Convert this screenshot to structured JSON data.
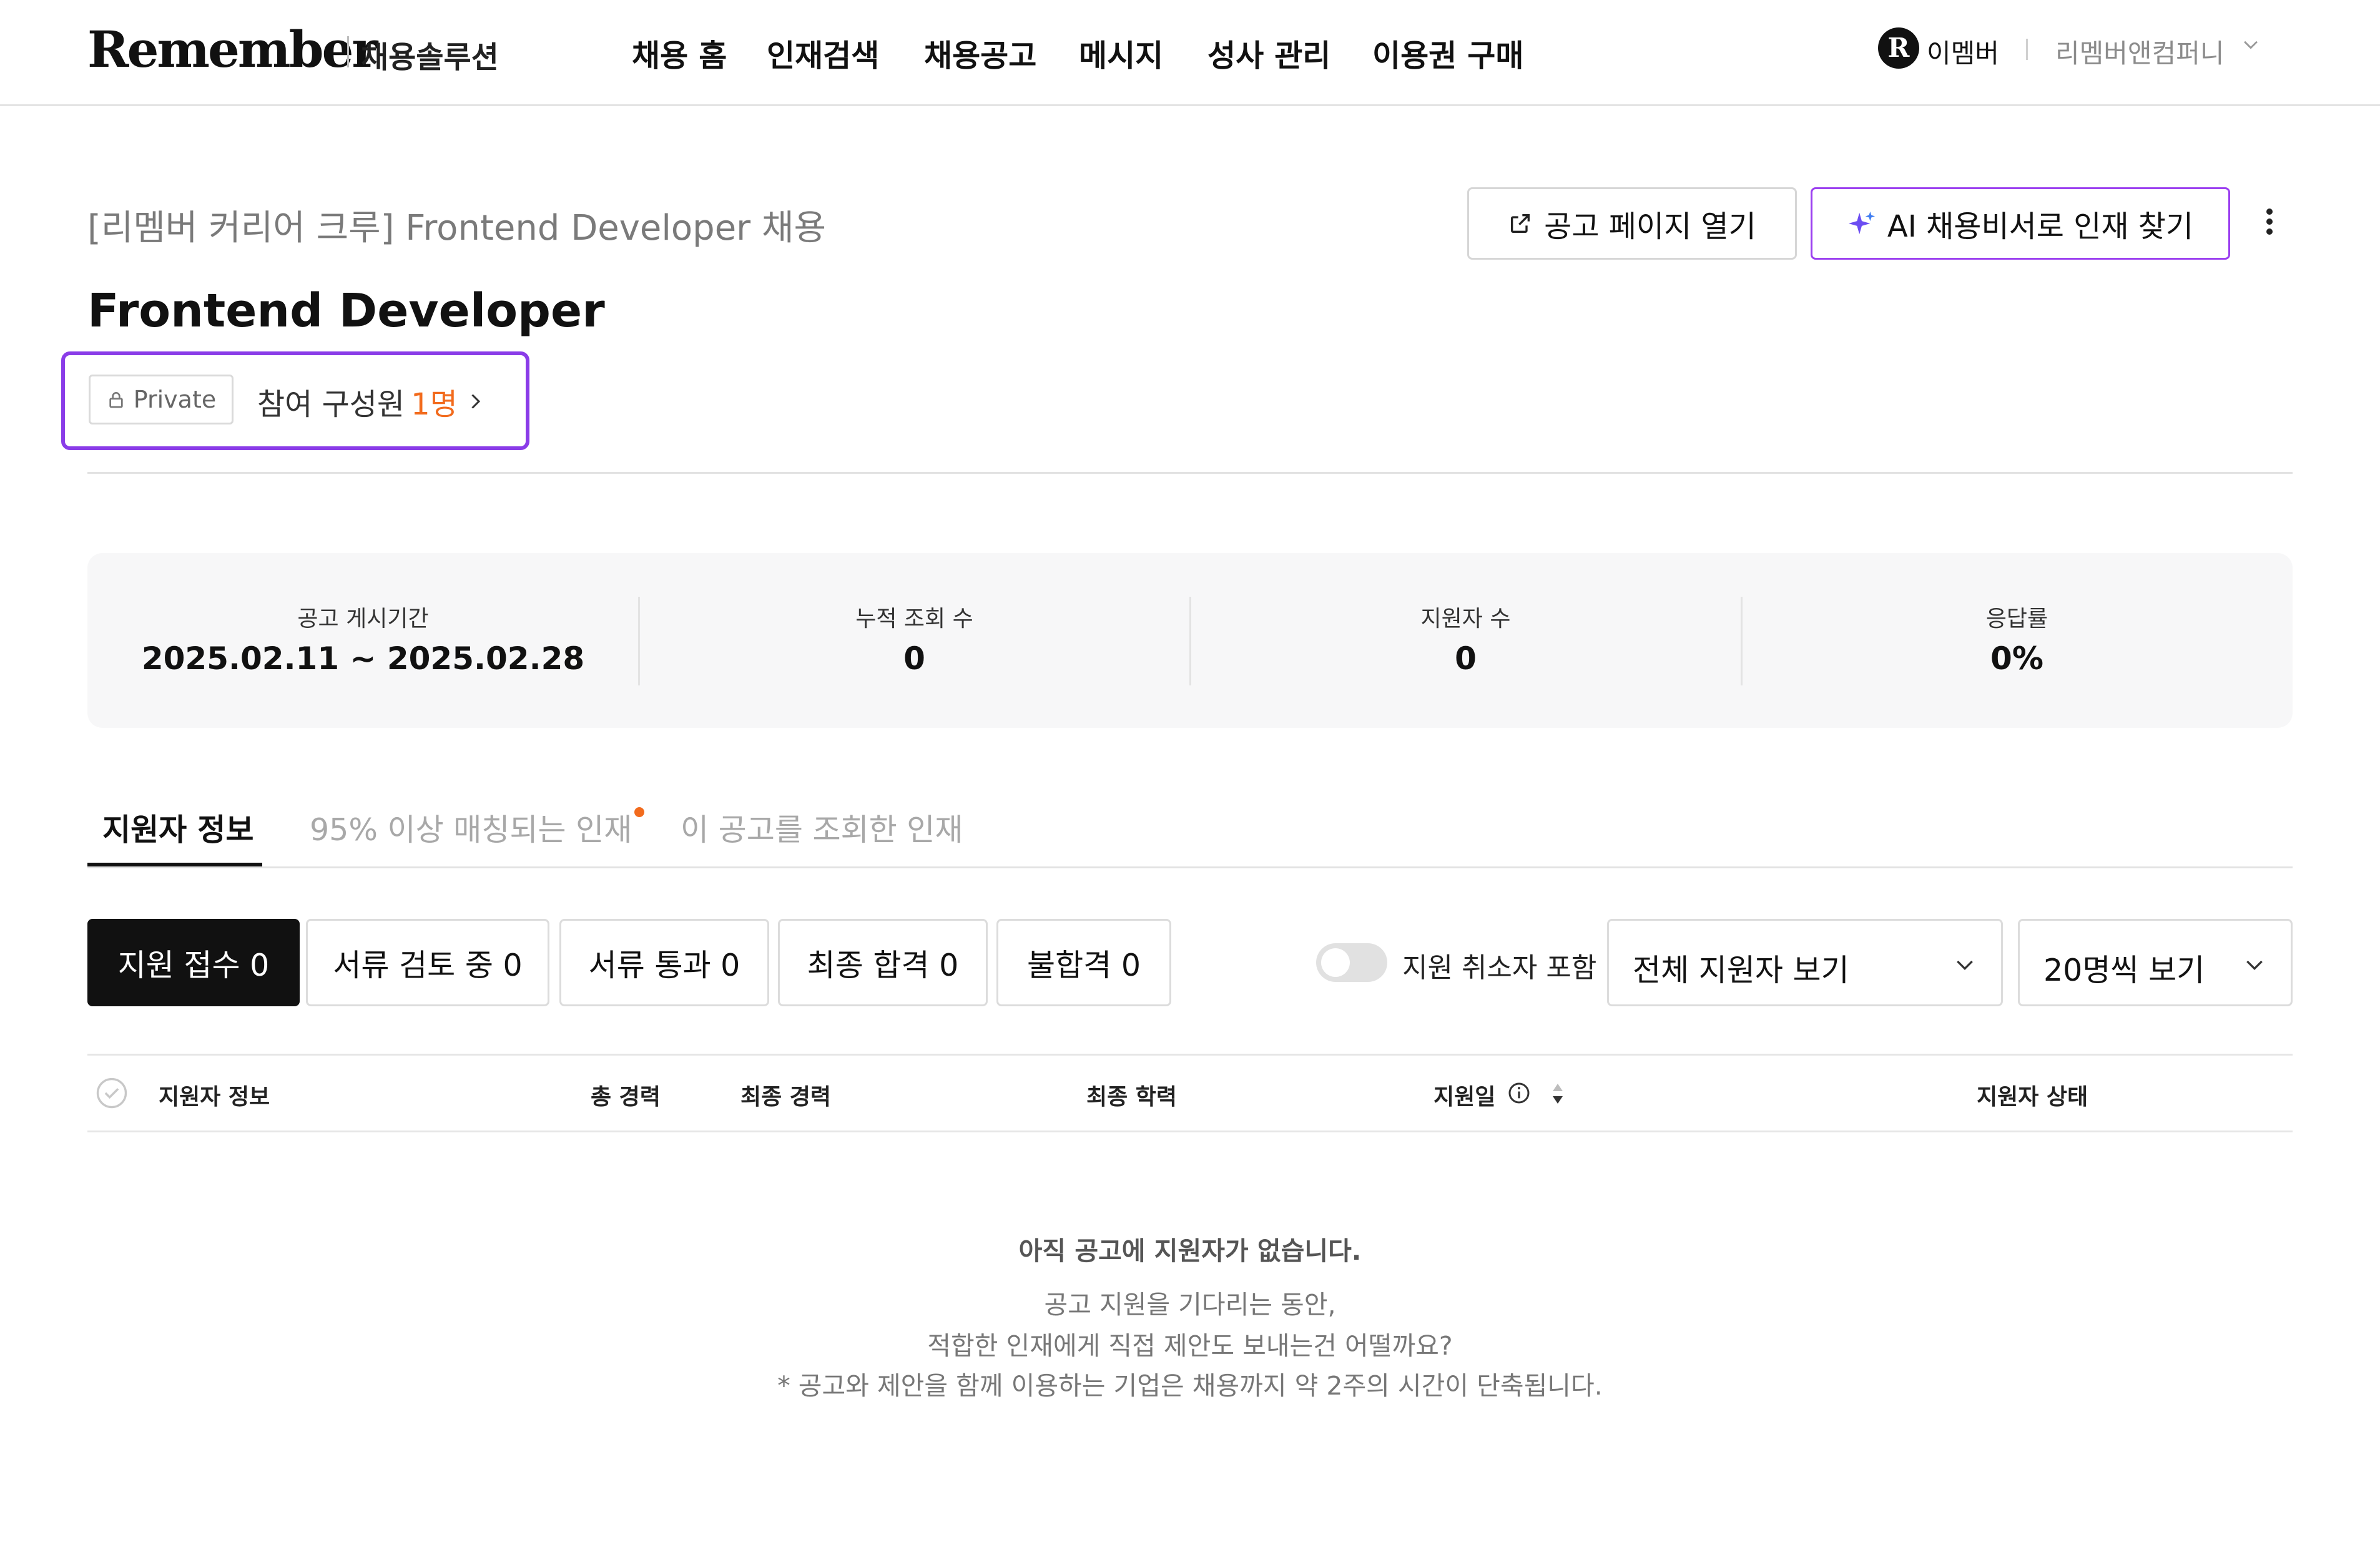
{
  "header": {
    "logo": "Remember",
    "logo_sub": "채용솔루션",
    "nav": [
      "채용 홈",
      "인재검색",
      "채용공고",
      "메시지",
      "성사 관리",
      "이용권 구매"
    ],
    "user_badge": "R",
    "user_name": "이멤버",
    "company": "리멤버앤컴퍼니"
  },
  "job": {
    "breadcrumb": "[리멤버 커리어 크루] Frontend Developer 채용",
    "title": "Frontend Developer",
    "private_label": "Private",
    "members_label": "참여 구성원",
    "members_count": "1명"
  },
  "actions": {
    "open_page": "공고 페이지 열기",
    "ai_search": "AI 채용비서로 인재 찾기"
  },
  "stats": [
    {
      "label": "공고 게시기간",
      "value": "2025.02.11 ~ 2025.02.28"
    },
    {
      "label": "누적 조회 수",
      "value": "0"
    },
    {
      "label": "지원자 수",
      "value": "0"
    },
    {
      "label": "응답률",
      "value": "0%"
    }
  ],
  "tabs": [
    {
      "label": "지원자 정보",
      "active": true
    },
    {
      "label": "95% 이상 매칭되는 인재",
      "active": false
    },
    {
      "label": "이 공고를 조회한 인재",
      "active": false
    }
  ],
  "status_filters": [
    "지원 접수 0",
    "서류 검토 중 0",
    "서류 통과 0",
    "최종 합격 0",
    "불합격 0"
  ],
  "toggle_label": "지원 취소자 포함",
  "applicant_select": "전체 지원자 보기",
  "page_size_select": "20명씩 보기",
  "table_headers": {
    "applicant": "지원자 정보",
    "total_career": "총 경력",
    "last_career": "최종 경력",
    "education": "최종 학력",
    "applied_date": "지원일",
    "status": "지원자 상태"
  },
  "empty": {
    "title": "아직 공고에 지원자가 없습니다.",
    "line1": "공고 지원을 기다리는 동안,",
    "line2": "적합한 인재에게 직접 제안도 보내는건 어떨까요?",
    "line3": "* 공고와 제안을 함께 이용하는 기업은 채용까지 약 2주의 시간이 단축됩니다."
  },
  "colors": {
    "accent_purple": "#8a3ce8",
    "accent_orange": "#f26b1d"
  }
}
